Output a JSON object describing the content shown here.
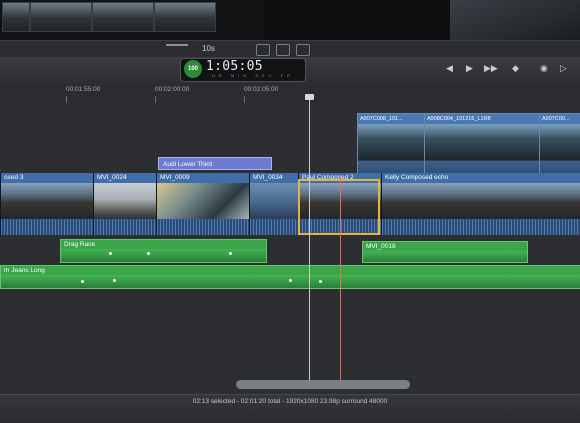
{
  "toolbar": {
    "zoom_value": "10s"
  },
  "timecode": {
    "badge": "100",
    "value": "1:05:05",
    "units": "HR MIN SEC FR"
  },
  "ruler": {
    "ticks": [
      "00:01:55:00",
      "00:02:00:00",
      "00:02:05:00"
    ]
  },
  "upper_clips": [
    {
      "label": "A907C008_101..."
    },
    {
      "label": "A908C004_101216_L1R8"
    },
    {
      "label": "A907C00..."
    }
  ],
  "title_clip": {
    "label": "Audi Lower Third"
  },
  "storyline": [
    {
      "label": "osed 3"
    },
    {
      "label": "MVI_0024"
    },
    {
      "label": "MVI_0009"
    },
    {
      "label": "MVI_0034"
    },
    {
      "label": "Paul Composed 2"
    },
    {
      "label": "Kelly Composed echo"
    }
  ],
  "audio": {
    "drag_race": "Drag Race",
    "mvi_0018": "MVI_0018",
    "music": "m Jeans Long"
  },
  "status": {
    "text": "02:13 selected - 02:01:20 total - 1920x1080 23.98p surround 48000"
  },
  "colors": {
    "storyline_header": "#3f6ea8",
    "audio_green": "#2f8e3c",
    "title_purple": "#6d7bd0",
    "selection_yellow": "#e3b53a",
    "skimmer_red": "#e96b57"
  }
}
